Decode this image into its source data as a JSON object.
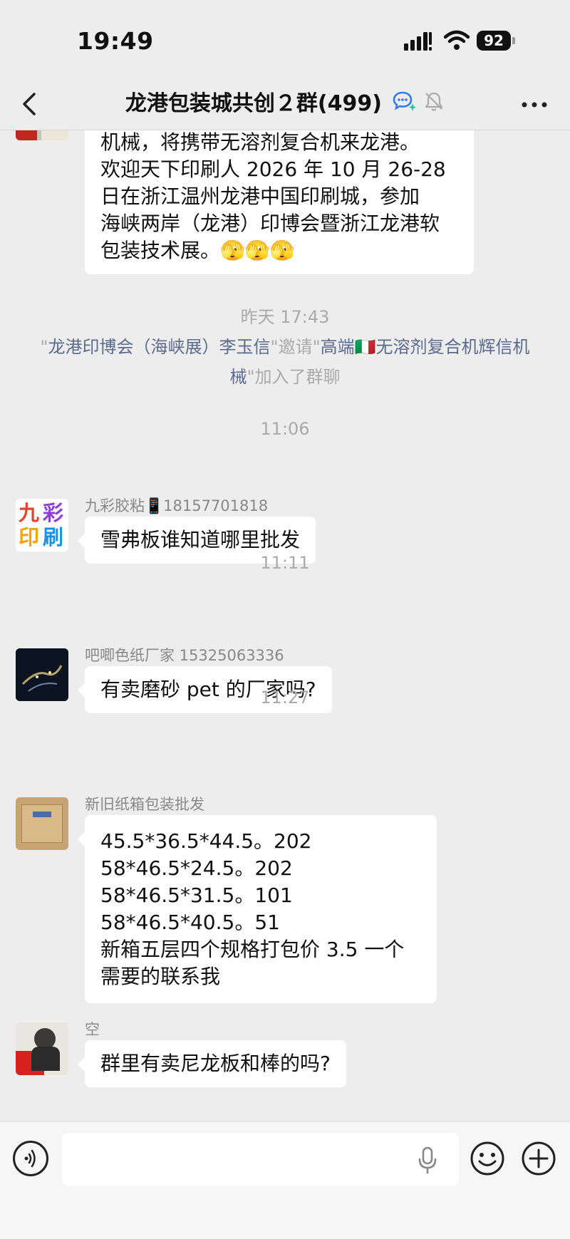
{
  "status_bar": {
    "time": "19:49",
    "battery": "92"
  },
  "header": {
    "title": "龙港包装城共创２群(499)"
  },
  "messages": {
    "m0": {
      "text": "龙港印博会展商邀约｜江苏江阴辉信\n机械，将携带无溶剂复合机来龙港。\n欢迎天下印刷人 2026 年 10 月 26-28\n日在浙江温州龙港中国印刷城，参加\n海峡两岸（龙港）印博会暨浙江龙港软\n包装技术展。🫣🫣🫣"
    },
    "ts1": "昨天 17:43",
    "system1": {
      "q1": "\"",
      "inviter": "龙港印博会（海峡展）李玉信",
      "mid": "\"邀请\"",
      "invitee": "高端🇮🇹无溶剂复合机辉信机械",
      "tail": "\"加入了群聊"
    },
    "ts2": "11:06",
    "m1": {
      "sender": "九彩胶粘📱18157701818",
      "text": "雪弗板谁知道哪里批发",
      "avatar_text": [
        "九",
        "彩",
        "印",
        "刷"
      ]
    },
    "ts3": "11:11",
    "m2": {
      "sender": "吧唧色纸厂家 15325063336",
      "text": "有卖磨砂 pet 的厂家吗?"
    },
    "ts4": "11:27",
    "m3": {
      "sender": "新旧纸箱包装批发",
      "text": "45.5*36.5*44.5。202\n58*46.5*24.5。202\n58*46.5*31.5。101\n58*46.5*40.5。51\n新箱五层四个规格打包价 3.5 一个\n需要的联系我"
    },
    "m4": {
      "sender": "空",
      "text": "群里有卖尼龙板和棒的吗?"
    }
  },
  "icons": [
    "back-icon",
    "ai-chat-icon",
    "mute-bell-icon",
    "more-icon",
    "voice-icon",
    "microphone-icon",
    "emoji-icon",
    "plus-icon"
  ]
}
